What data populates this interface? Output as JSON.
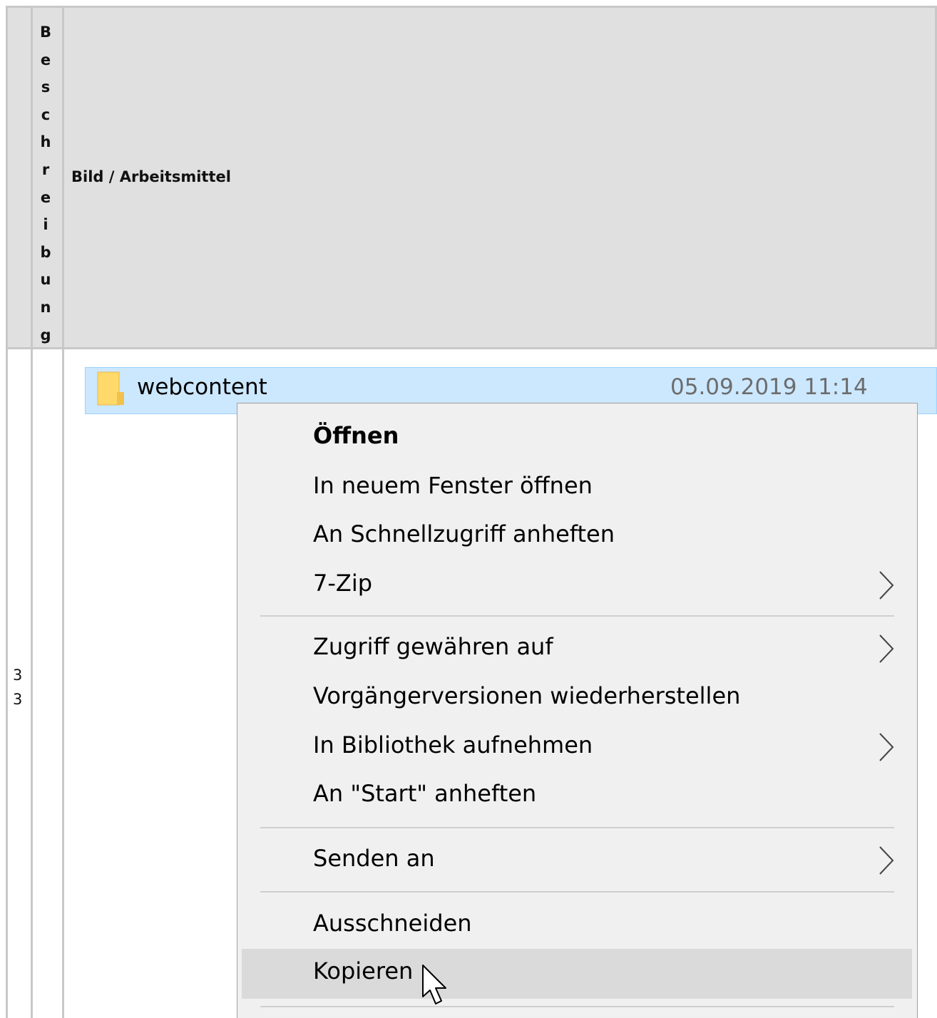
{
  "table": {
    "header_col2_label": "Beschreibung",
    "header_col2_letters": [
      "B",
      "e",
      "s",
      "c",
      "h",
      "r",
      "e",
      "i",
      "b",
      "u",
      "n",
      "g"
    ],
    "header_col3_label": "Bild / Arbeitsmittel",
    "row_number_digits": [
      "3",
      "3"
    ]
  },
  "explorer": {
    "folder_name": "webcontent",
    "folder_date": "05.09.2019 11:14"
  },
  "context_menu": {
    "items": [
      {
        "label": "Öffnen",
        "bold": true,
        "submenu": false
      },
      {
        "label": "In neuem Fenster öffnen",
        "submenu": false
      },
      {
        "label": "An Schnellzugriff anheften",
        "submenu": false
      },
      {
        "label": "7-Zip",
        "submenu": true
      },
      {
        "label": "Zugriff gewähren auf",
        "submenu": true
      },
      {
        "label": "Vorgängerversionen wiederherstellen",
        "submenu": false
      },
      {
        "label": "In Bibliothek aufnehmen",
        "submenu": true
      },
      {
        "label": "An \"Start\" anheften",
        "submenu": false
      },
      {
        "label": "Senden an",
        "submenu": true
      },
      {
        "label": "Ausschneiden",
        "submenu": false
      },
      {
        "label": "Kopieren",
        "submenu": false,
        "hovered": true
      }
    ]
  },
  "colors": {
    "header_bg": "#e0e0e0",
    "selection_bg": "#cce8ff",
    "menu_bg": "#f0f0f0",
    "hover_bg": "#dadada"
  }
}
